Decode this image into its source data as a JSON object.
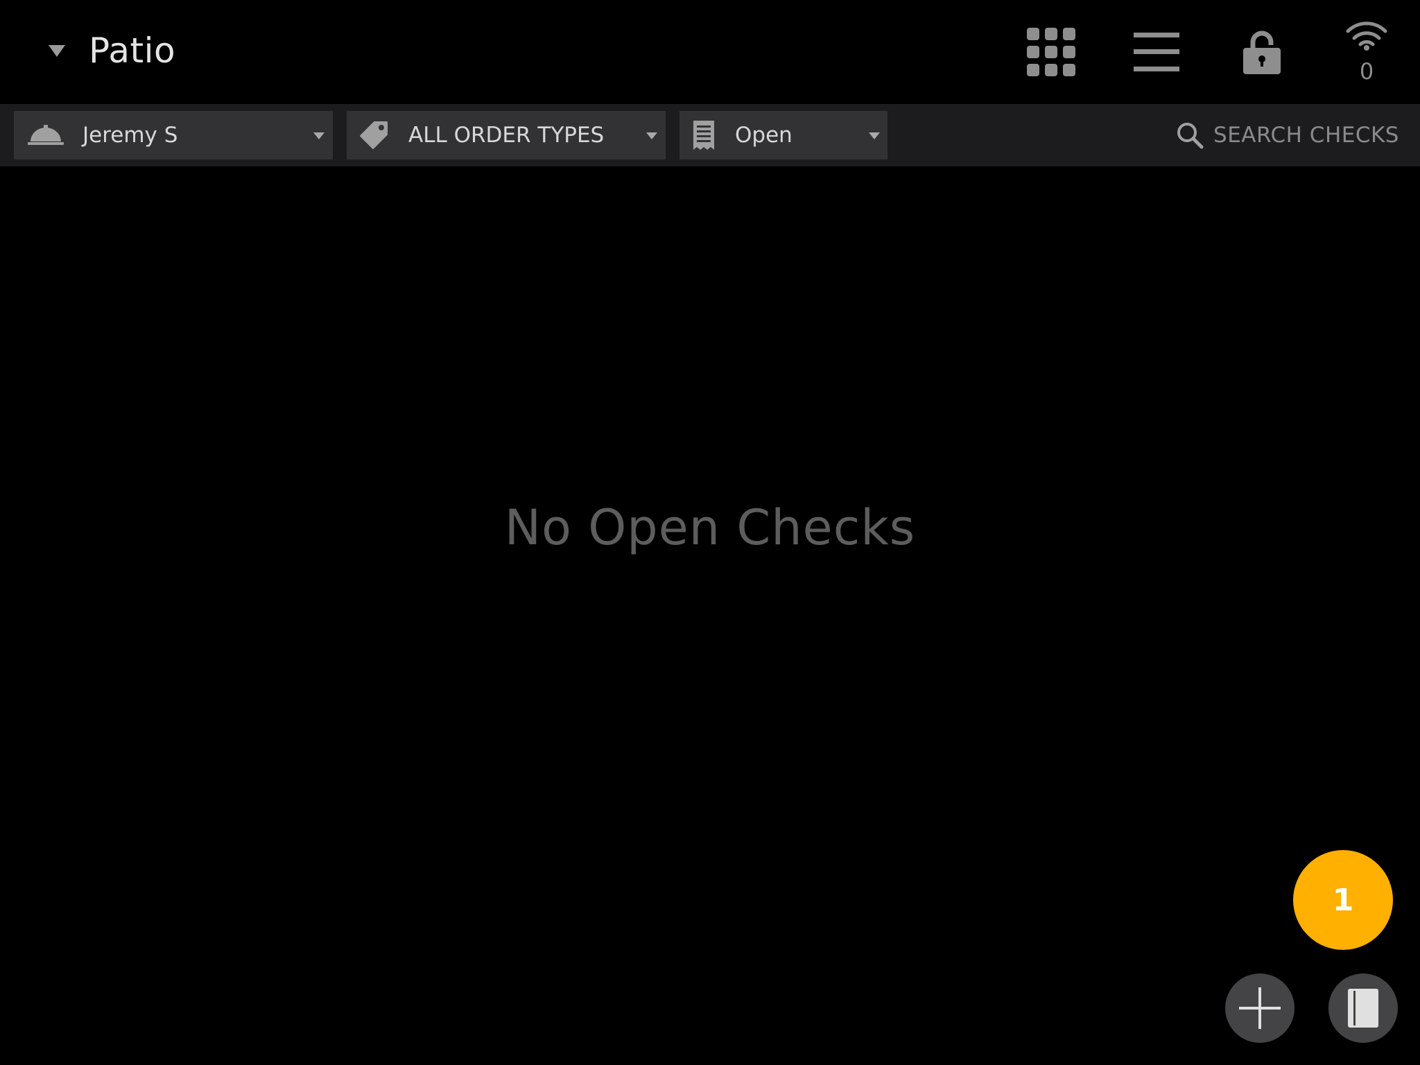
{
  "header": {
    "area_title": "Patio",
    "icons": {
      "area_dropdown": "caret-down-icon",
      "apps": "grid-icon",
      "menu": "hamburger-menu-icon",
      "lock": "lock-icon",
      "connection": "wifi-icon"
    },
    "offline_count": "0"
  },
  "filters": {
    "server": {
      "label": "Jeremy S",
      "icon": "service-bell-icon"
    },
    "order_type": {
      "label": "ALL ORDER TYPES",
      "icon": "tag-icon"
    },
    "status": {
      "label": "Open",
      "icon": "receipt-icon"
    },
    "search": {
      "label": "SEARCH CHECKS",
      "icon": "search-icon"
    }
  },
  "main": {
    "empty_message": "No Open Checks"
  },
  "fab": {
    "badge_count": "1",
    "add_icon": "plus-icon",
    "panel_icon": "panel-icon"
  },
  "colors": {
    "background": "#000000",
    "filter_bar": "#1c1c1e",
    "filter_button": "#323234",
    "accent_badge": "#ffb000",
    "round_button": "#444446",
    "empty_text": "#5d5d5d"
  }
}
